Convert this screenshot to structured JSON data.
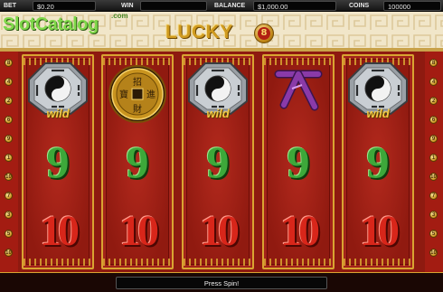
{
  "topbar": {
    "bet_label": "BET",
    "bet_value": "$0.20",
    "win_label": "WIN",
    "win_value": "",
    "balance_label": "BALANCE",
    "balance_value": "$1,000.00",
    "coins_label": "COINS",
    "coins_value": "100000"
  },
  "watermark": {
    "text": "SlotCatalog",
    "suffix": ".com"
  },
  "logo": {
    "text": "LUCKY",
    "coin_glyph": "8"
  },
  "paylines": {
    "left": [
      "8",
      "4",
      "2",
      "6",
      "9",
      "1",
      "10",
      "7",
      "3",
      "5",
      "10"
    ],
    "right": [
      "8",
      "4",
      "2",
      "6",
      "9",
      "1",
      "10",
      "7",
      "3",
      "5",
      "10"
    ]
  },
  "reels": [
    {
      "top": "wild",
      "mid": "9",
      "bot": "10"
    },
    {
      "top": "coin",
      "mid": "9",
      "bot": "10"
    },
    {
      "top": "wild",
      "mid": "9",
      "bot": "10"
    },
    {
      "top": "glyph",
      "mid": "9",
      "bot": "10"
    },
    {
      "top": "wild",
      "mid": "9",
      "bot": "10"
    }
  ],
  "symbols": {
    "wild_label": "wild",
    "nine": "9",
    "ten": "10",
    "coin_chars": [
      "招",
      "進",
      "寶",
      "財"
    ]
  },
  "colors": {
    "reel_red": "#a3231a",
    "gold": "#d9a431",
    "nine_green": "#3da83a",
    "ten_red": "#d8261a",
    "glyph_purple": "#8a3aa8"
  },
  "status": {
    "message": "Press Spin!"
  }
}
